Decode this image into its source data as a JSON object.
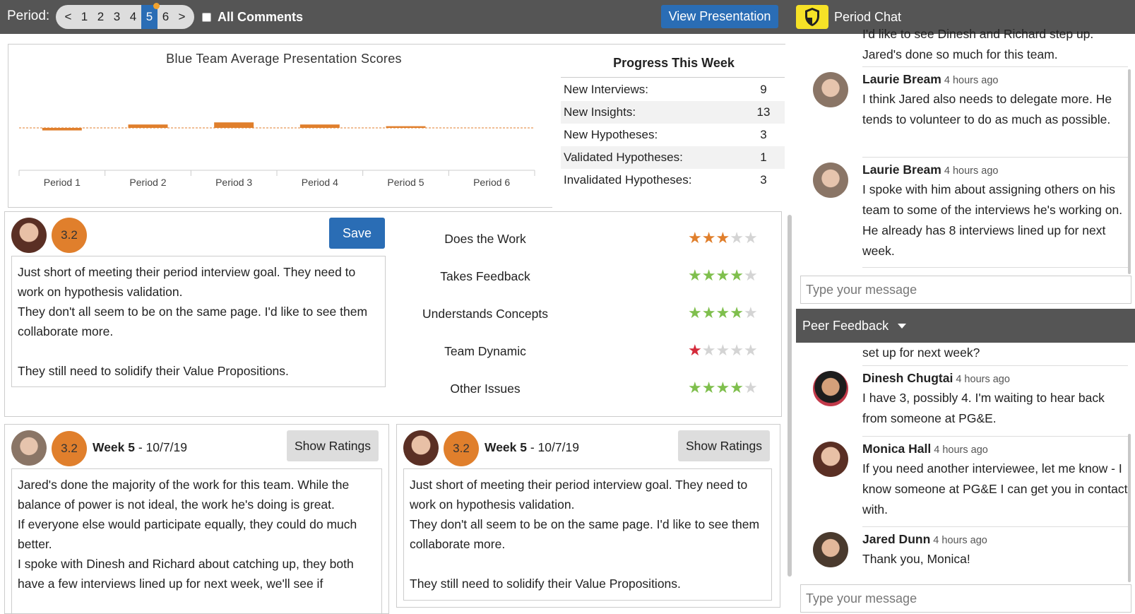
{
  "topbar": {
    "period_label": "Period:",
    "pager": [
      "<",
      "1",
      "2",
      "3",
      "4",
      "5",
      "6",
      ">"
    ],
    "active_page": "5",
    "all_comments": "All Comments",
    "view_presentation": "View Presentation",
    "chat_title": "Period Chat"
  },
  "chart_data": {
    "type": "bar",
    "title": "Blue Team Average Presentation Scores",
    "categories": [
      "Period 1",
      "Period 2",
      "Period 3",
      "Period 4",
      "Period 5",
      "Period 6"
    ],
    "values": [
      -0.6,
      0.8,
      1.3,
      0.8,
      0.4,
      null
    ],
    "baseline": 0,
    "ylim": [
      -3,
      3
    ],
    "color": "#e07f2c"
  },
  "progress": {
    "title": "Progress This Week",
    "rows": [
      {
        "label": "New Interviews:",
        "value": "9"
      },
      {
        "label": "New Insights:",
        "value": "13"
      },
      {
        "label": "New Hypotheses:",
        "value": "3"
      },
      {
        "label": "Validated Hypotheses:",
        "value": "1"
      },
      {
        "label": "Invalidated Hypotheses:",
        "value": "3"
      }
    ]
  },
  "editor": {
    "score": "3.2",
    "save_label": "Save",
    "text": "Just short of meeting their period interview goal. They need to work on hypothesis validation.\nThey don't all seem to be on the same page. I'd like to see them collaborate more.\n\nThey still need to solidify their Value Propositions."
  },
  "ratings": [
    {
      "label": "Does the Work",
      "stars": 3,
      "color": "#e07f2c"
    },
    {
      "label": "Takes Feedback",
      "stars": 4,
      "color": "#7fbf4d"
    },
    {
      "label": "Understands Concepts",
      "stars": 4,
      "color": "#7fbf4d"
    },
    {
      "label": "Team Dynamic",
      "stars": 1,
      "color": "#d42a3a"
    },
    {
      "label": "Other Issues",
      "stars": 4,
      "color": "#7fbf4d"
    }
  ],
  "cards": [
    {
      "score": "3.2",
      "week": "Week 5",
      "date": " - 10/7/19",
      "show_label": "Show Ratings",
      "text": "Jared's done the majority of the work for this team. While the balance of power is not ideal, the work he's doing is great.\nIf everyone else would participate equally, they could do much better.\nI spoke with Dinesh and Richard about catching up, they both have a few interviews lined up for next week, we'll see if"
    },
    {
      "score": "3.2",
      "week": "Week 5",
      "date": " - 10/7/19",
      "show_label": "Show Ratings",
      "text": "Just short of meeting their period interview goal. They need to work on hypothesis validation.\nThey don't all seem to be on the same page. I'd like to see them collaborate more.\n\nThey still need to solidify their Value Propositions."
    }
  ],
  "period_chat": {
    "partial_text": "I'd like to see Dinesh and Richard step up. Jared's done so much for this team.",
    "messages": [
      {
        "name": "Laurie Bream",
        "time": "4 hours ago",
        "text": "I think Jared also needs to delegate more. He tends to volunteer to do as much as possible."
      },
      {
        "name": "Laurie Bream",
        "time": "4 hours ago",
        "text": "I spoke with him about assigning others on his team to some of the interviews he's working on. He already has 8 interviews lined up for next week."
      }
    ],
    "placeholder": "Type your message"
  },
  "peer_feedback": {
    "title": "Peer Feedback",
    "partial_text": "set up for next week?",
    "messages": [
      {
        "name": "Dinesh Chugtai",
        "time": "4 hours ago",
        "text": "I have 3, possibly 4. I'm waiting to hear back from someone at PG&E."
      },
      {
        "name": "Monica Hall",
        "time": "4 hours ago",
        "text": "If you need another interviewee, let me know - I know someone at PG&E I can get you in contact with."
      },
      {
        "name": "Jared Dunn",
        "time": "4 hours ago",
        "text": "Thank you, Monica!"
      }
    ],
    "placeholder": "Type your message"
  }
}
